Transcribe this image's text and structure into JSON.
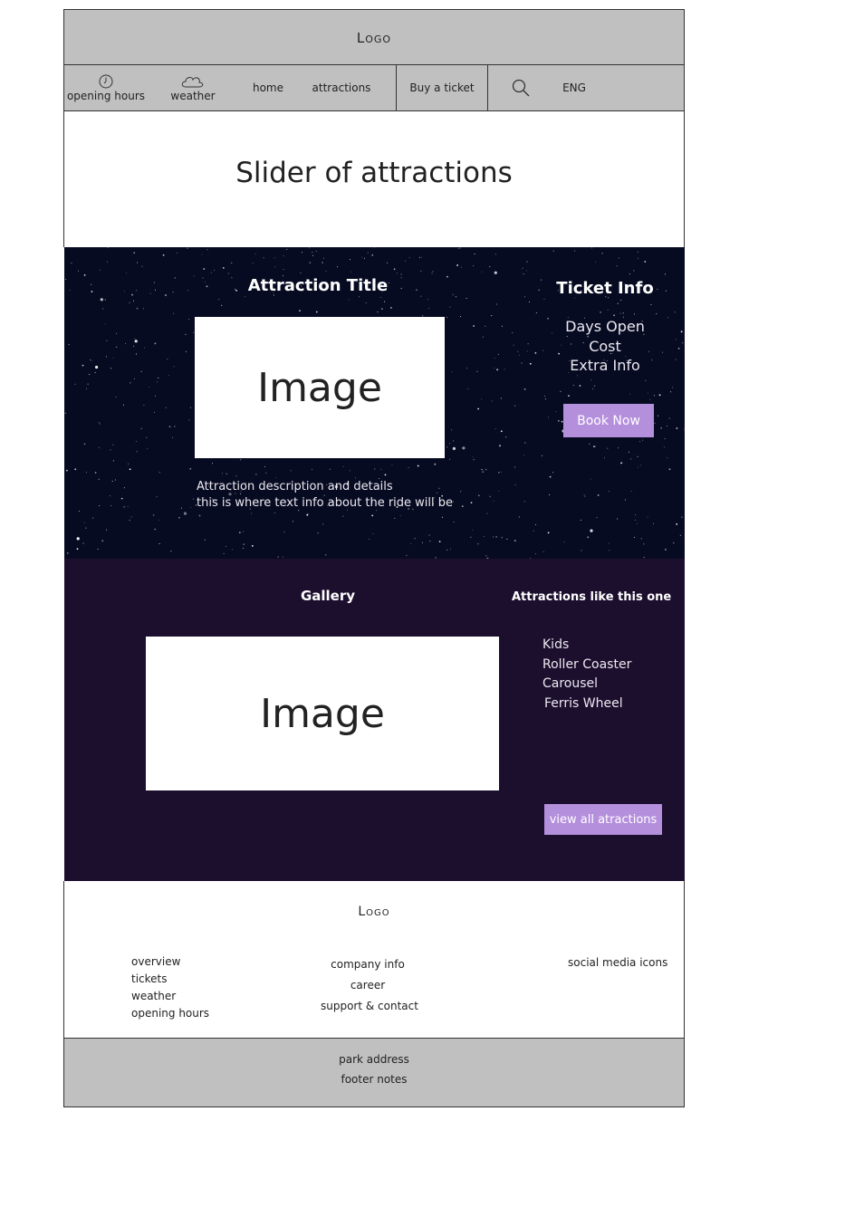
{
  "header": {
    "logo": "Logo"
  },
  "nav": {
    "opening_hours": "opening hours",
    "weather": "weather",
    "home": "home",
    "attractions": "attractions",
    "buy_ticket": "Buy a ticket",
    "language": "ENG",
    "icons": [
      "clock-icon",
      "cloud-icon",
      "search-icon"
    ]
  },
  "slider": {
    "title": "Slider of attractions"
  },
  "attraction": {
    "title": "Attraction Title",
    "image_label": "Image",
    "description_line1": "Attraction description and details",
    "description_line2": "this is where text info about the ride will be"
  },
  "ticket_info": {
    "heading": "Ticket Info",
    "days_open": "Days Open",
    "cost": "Cost",
    "extra_info": "Extra Info",
    "book_button": "Book Now"
  },
  "gallery": {
    "heading": "Gallery",
    "image_label": "Image"
  },
  "similar": {
    "heading": "Attractions like this one",
    "items": [
      "Kids",
      "Roller Coaster",
      "Carousel",
      "Ferris Wheel"
    ],
    "view_all_button": "view all atractions"
  },
  "footer": {
    "logo": "Logo",
    "col1": [
      "overview",
      "tickets",
      "weather",
      "opening hours"
    ],
    "col2": [
      "company info",
      "career",
      "support & contact"
    ],
    "social": "social media icons",
    "address": "park address",
    "notes": "footer notes"
  },
  "colors": {
    "header_gray": "#c0c0c0",
    "night_sky": "#06061a",
    "gallery_bg": "#1c0f2e",
    "button_purple": "#b48fdc"
  }
}
